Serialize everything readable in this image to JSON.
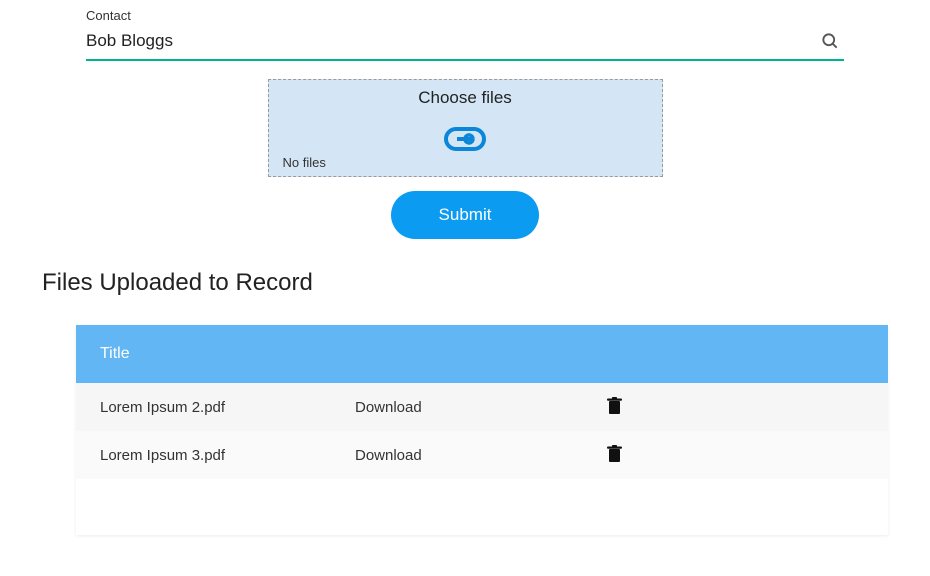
{
  "contact": {
    "label": "Contact",
    "value": "Bob Bloggs"
  },
  "dropzone": {
    "title": "Choose files",
    "status": "No files"
  },
  "actions": {
    "submit": "Submit"
  },
  "section": {
    "heading": "Files Uploaded to Record"
  },
  "table": {
    "header": "Title",
    "download_label": "Download",
    "rows": [
      {
        "title": "Lorem Ipsum 2.pdf"
      },
      {
        "title": "Lorem Ipsum 3.pdf"
      }
    ]
  },
  "icons": {
    "search": "search-icon",
    "paperclip": "paperclip-icon",
    "trash": "trash-icon"
  }
}
